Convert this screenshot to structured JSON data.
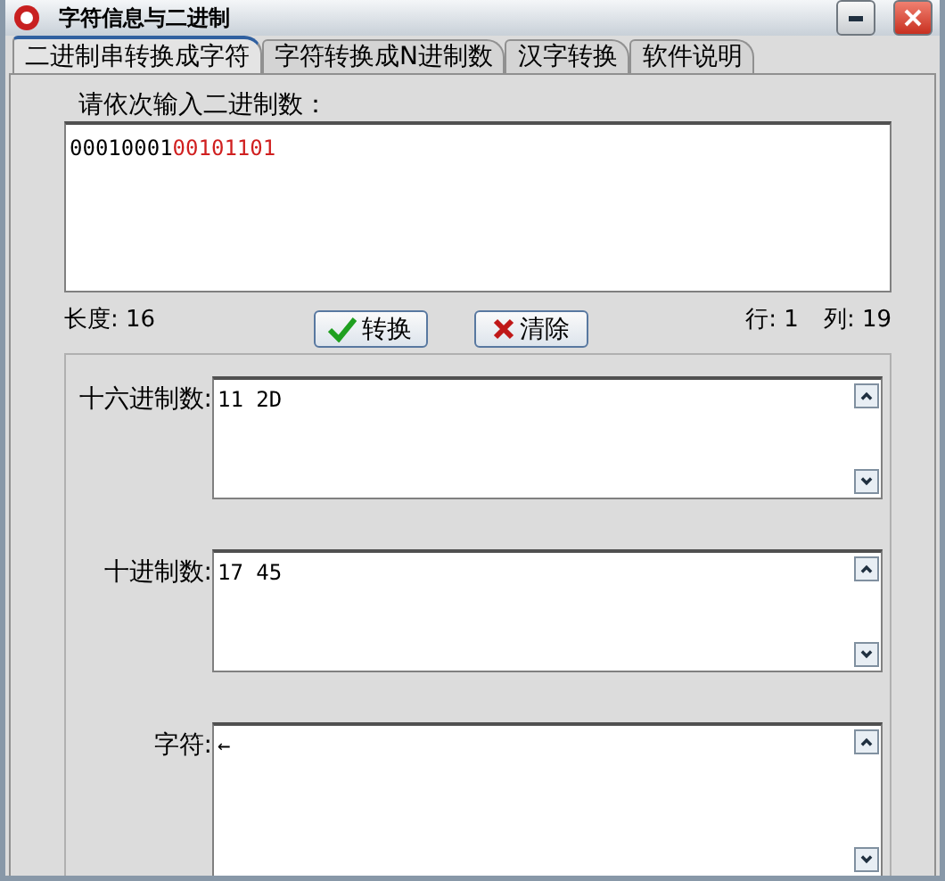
{
  "window": {
    "title": "字符信息与二进制"
  },
  "tabs": [
    {
      "label": "二进制串转换成字符",
      "selected": true
    },
    {
      "label": "字符转换成N进制数",
      "selected": false
    },
    {
      "label": "汉字转换",
      "selected": false
    },
    {
      "label": "软件说明",
      "selected": false
    }
  ],
  "input_group": {
    "title": "请依次输入二进制数：",
    "segments": [
      {
        "text": "00010001",
        "color": "#000000"
      },
      {
        "text": "00101101",
        "color": "#d02020"
      }
    ]
  },
  "status": {
    "length": "长度: 16",
    "row": "行: 1",
    "column": "列: 19"
  },
  "buttons": [
    {
      "kind": "ok",
      "label": "转换"
    },
    {
      "kind": "clear",
      "label": "清除"
    }
  ],
  "outputs": [
    {
      "label": "十六进制数:",
      "value": "11 2D"
    },
    {
      "label": "十进制数:",
      "value": "17 45"
    },
    {
      "label": "字符:",
      "value": "←"
    }
  ]
}
